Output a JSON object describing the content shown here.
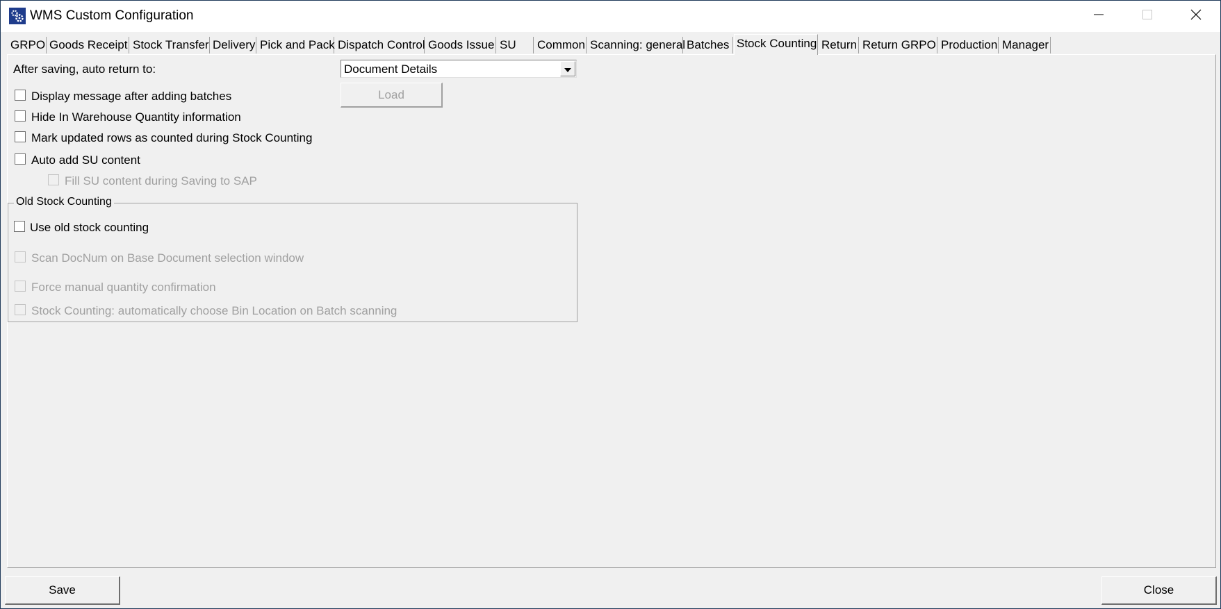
{
  "window": {
    "title": "WMS Custom Configuration",
    "icon": "gears-icon",
    "controls": {
      "minimize": "minimize-icon",
      "maximize": "maximize-icon",
      "close": "close-icon"
    }
  },
  "tabs": [
    {
      "label": "GRPO",
      "active": false
    },
    {
      "label": "Goods Receipt",
      "active": false
    },
    {
      "label": "Stock Transfer",
      "active": false
    },
    {
      "label": "Delivery",
      "active": false
    },
    {
      "label": "Pick and Pack",
      "active": false
    },
    {
      "label": "Dispatch Control",
      "active": false
    },
    {
      "label": "Goods Issue",
      "active": false
    },
    {
      "label": "SU",
      "active": false
    },
    {
      "label": "Common",
      "active": false
    },
    {
      "label": "Scanning: general",
      "active": false
    },
    {
      "label": "Batches",
      "active": false
    },
    {
      "label": "Stock Counting",
      "active": true
    },
    {
      "label": "Return",
      "active": false
    },
    {
      "label": "Return GRPO",
      "active": false
    },
    {
      "label": "Production",
      "active": false
    },
    {
      "label": "Manager",
      "active": false
    }
  ],
  "stock_counting": {
    "auto_return_label": "After saving, auto return to:",
    "auto_return_value": "Document Details",
    "load_button": "Load",
    "options": [
      {
        "label": "Display message after adding batches",
        "checked": false,
        "enabled": true
      },
      {
        "label": "Hide In Warehouse Quantity information",
        "checked": false,
        "enabled": true
      },
      {
        "label": "Mark updated rows as counted during Stock Counting",
        "checked": false,
        "enabled": true
      },
      {
        "label": "Auto add SU content",
        "checked": false,
        "enabled": true
      },
      {
        "label": "Fill SU content during Saving to SAP",
        "checked": false,
        "enabled": false
      }
    ],
    "old_group": {
      "title": "Old Stock Counting",
      "options": [
        {
          "label": "Use old stock counting",
          "checked": false,
          "enabled": true
        },
        {
          "label": "Scan DocNum on Base Document selection window",
          "checked": false,
          "enabled": false
        },
        {
          "label": "Force manual quantity confirmation",
          "checked": false,
          "enabled": false
        },
        {
          "label": "Stock Counting: automatically choose Bin Location on Batch scanning",
          "checked": false,
          "enabled": false
        }
      ]
    }
  },
  "footer": {
    "save": "Save",
    "close": "Close"
  }
}
